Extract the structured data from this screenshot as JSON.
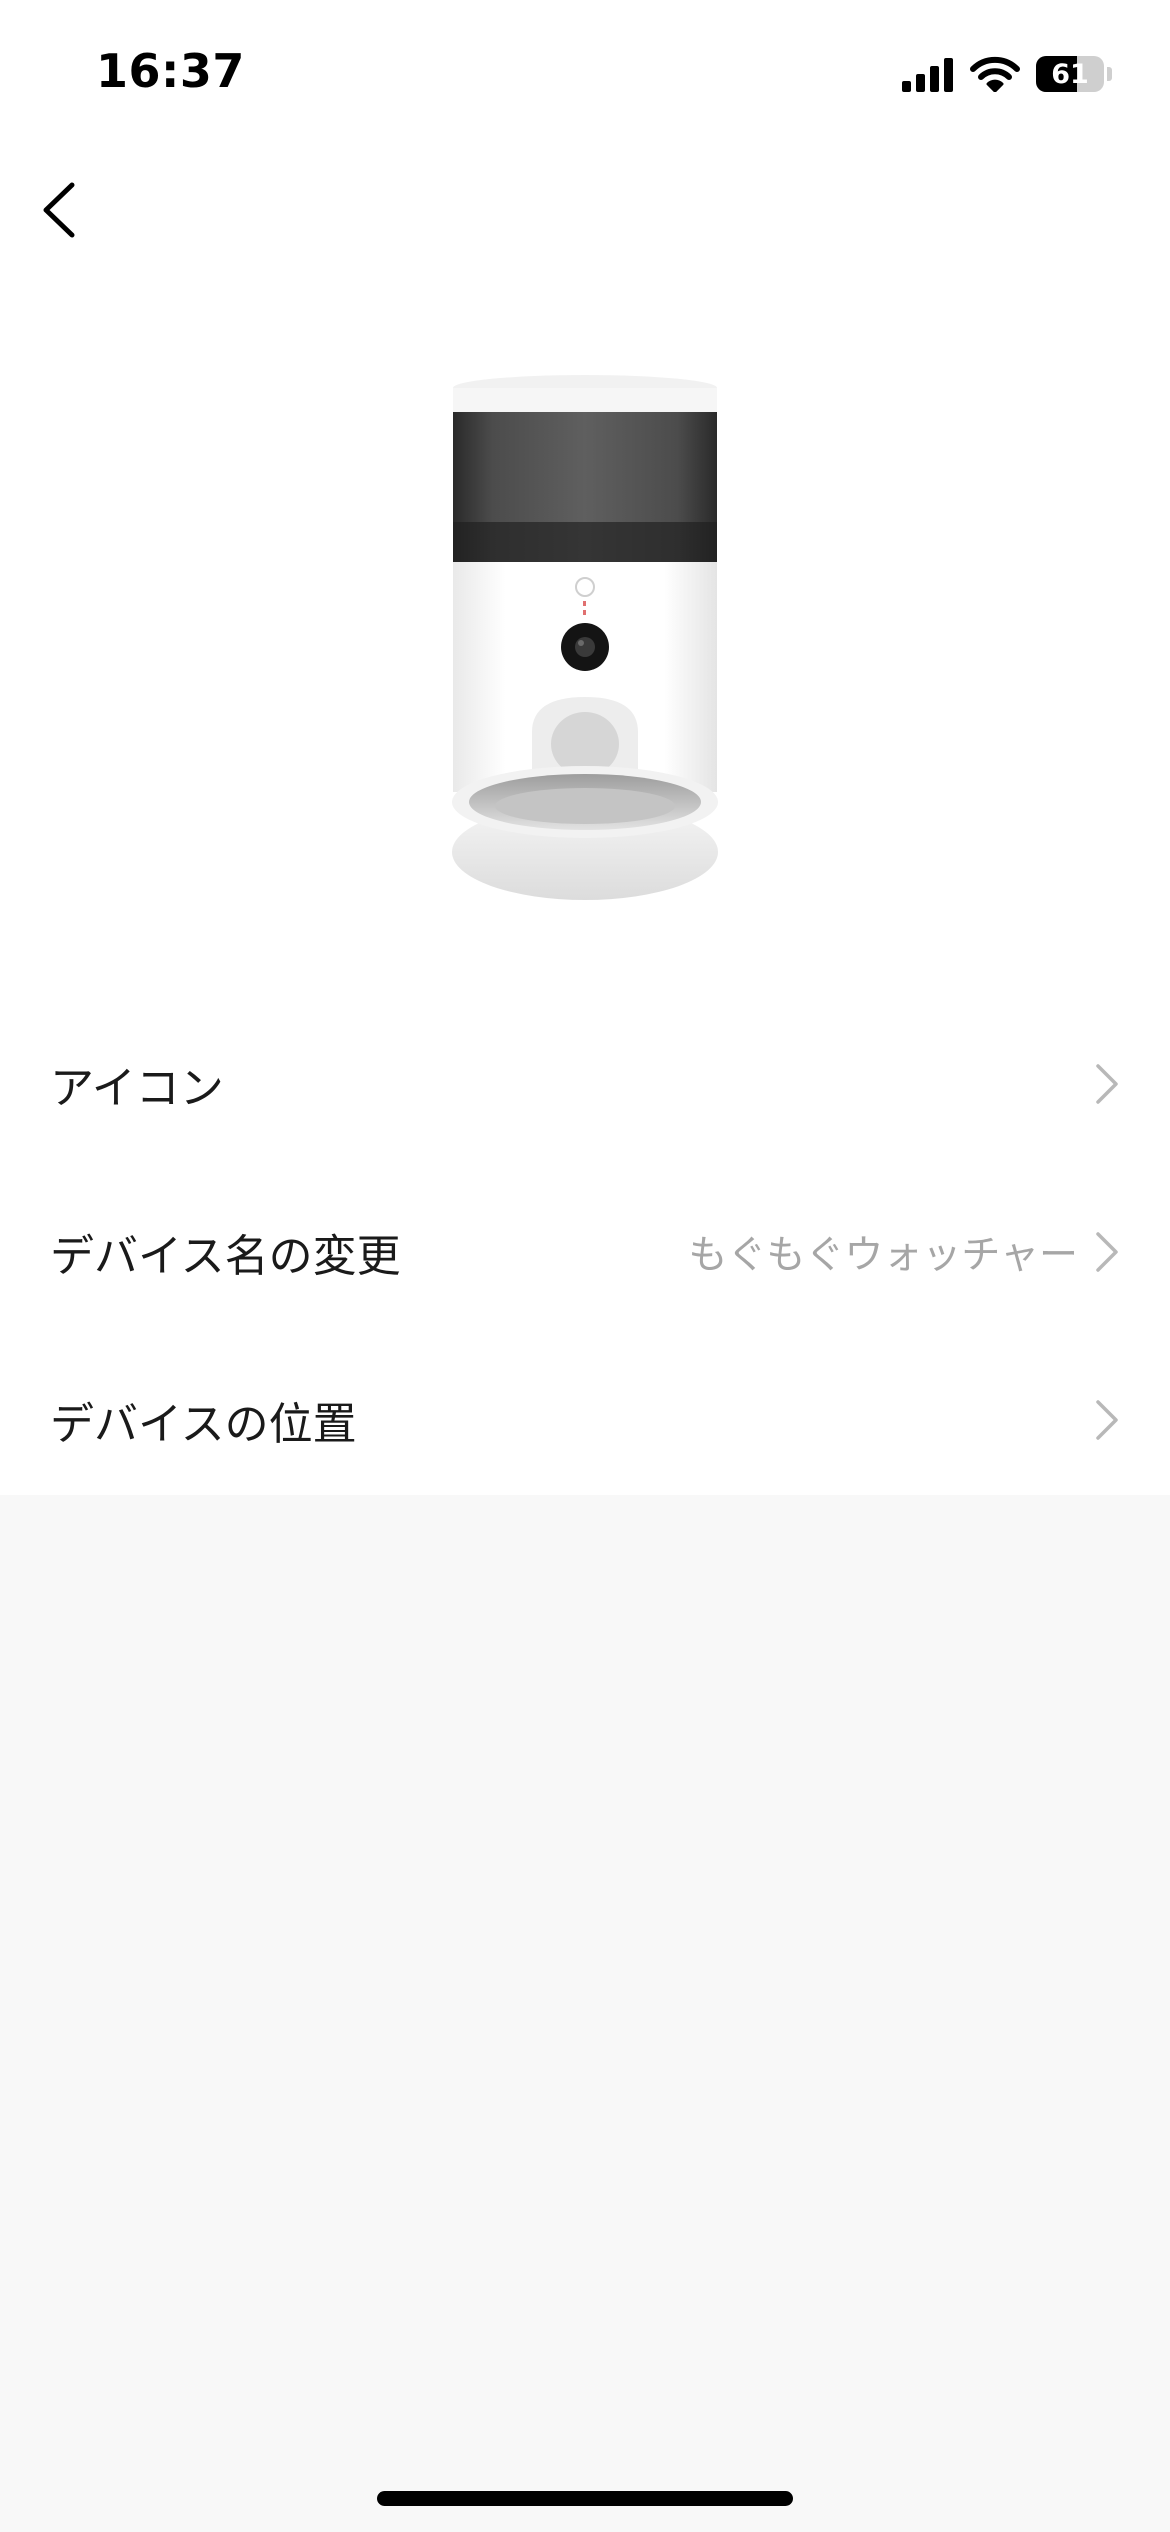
{
  "status_bar": {
    "time": "16:37",
    "battery_level": "61",
    "battery_fraction": 0.61,
    "signal_icon": "cellular-signal-icon",
    "wifi_icon": "wifi-icon"
  },
  "nav": {
    "back_icon": "chevron-left-icon"
  },
  "device": {
    "image": "pet-feeder-camera-image"
  },
  "settings": [
    {
      "label": "アイコン",
      "value": ""
    },
    {
      "label": "デバイス名の変更",
      "value": "もぐもぐウォッチャー"
    },
    {
      "label": "デバイスの位置",
      "value": ""
    }
  ],
  "colors": {
    "panel": "#ffffff",
    "background": "#f8f8f8",
    "text": "#1a1a1a",
    "secondary_text": "#a6a6a6",
    "chevron": "#b8b8b8"
  }
}
